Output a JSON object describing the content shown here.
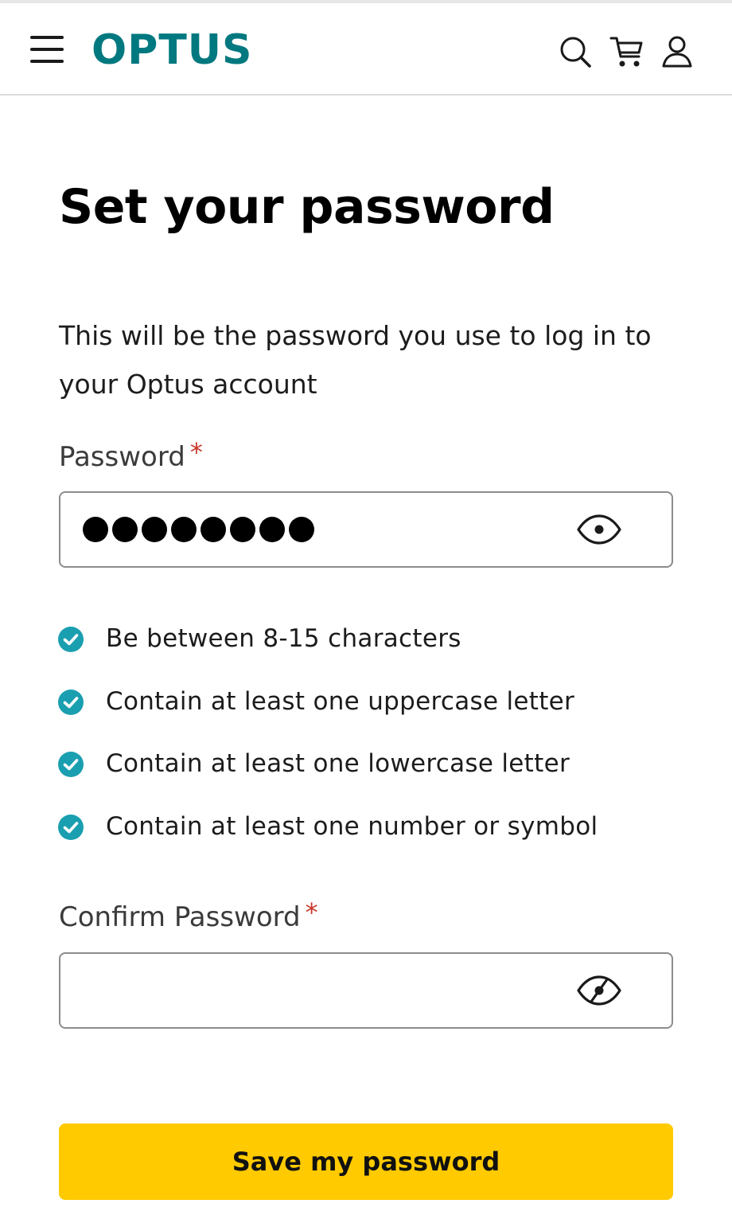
{
  "header": {
    "logo_text": "OPTUS",
    "menu_icon": "hamburger-menu-icon",
    "search_icon": "search-icon",
    "cart_icon": "cart-icon",
    "account_icon": "user-icon",
    "brand_color": "#00787f"
  },
  "page": {
    "title": "Set your password",
    "intro": "This will be the password you use to log in to your Optus account"
  },
  "password": {
    "label": "Password",
    "required_marker": "*",
    "masked_length": 8,
    "toggle_icon": "eye-icon"
  },
  "requirements": [
    {
      "text": "Be between 8-15 characters",
      "met": true
    },
    {
      "text": "Contain at least one uppercase letter",
      "met": true
    },
    {
      "text": "Contain at least one lowercase letter",
      "met": true
    },
    {
      "text": "Contain at least one number or symbol",
      "met": true
    }
  ],
  "confirm_password": {
    "label": "Confirm Password",
    "required_marker": "*",
    "value": "",
    "toggle_icon": "eye-slash-icon"
  },
  "save_button": {
    "label": "Save my password",
    "color": "#ffca00"
  },
  "colors": {
    "check": "#1a9fb0",
    "required": "#c8372a"
  }
}
